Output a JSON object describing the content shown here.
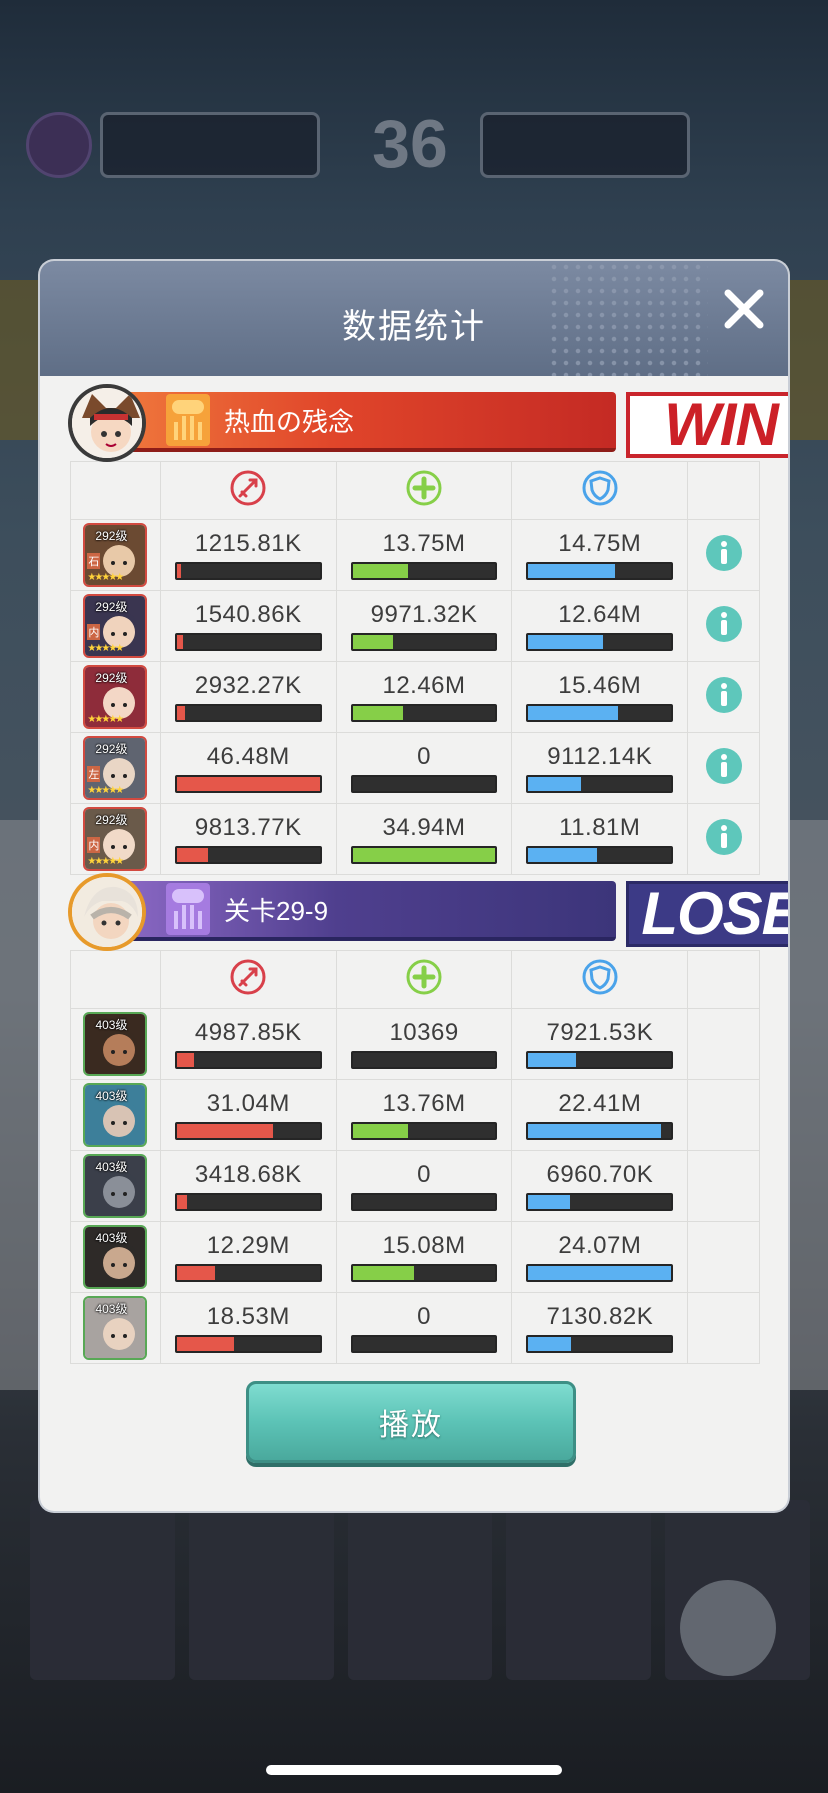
{
  "background": {
    "score": "36"
  },
  "modal": {
    "title": "数据统计",
    "play_label": "播放"
  },
  "team_win": {
    "name": "热血の残念",
    "result": "WIN",
    "heroes": [
      {
        "level": "292级",
        "tag": "石",
        "dmg": "1215.81K",
        "heal": "13.75M",
        "tank": "14.75M",
        "dmg_pct": 3,
        "heal_pct": 39,
        "tank_pct": 61
      },
      {
        "level": "292级",
        "tag": "内",
        "dmg": "1540.86K",
        "heal": "9971.32K",
        "tank": "12.64M",
        "dmg_pct": 4,
        "heal_pct": 28,
        "tank_pct": 52
      },
      {
        "level": "292级",
        "tag": "",
        "dmg": "2932.27K",
        "heal": "12.46M",
        "tank": "15.46M",
        "dmg_pct": 6,
        "heal_pct": 35,
        "tank_pct": 63
      },
      {
        "level": "292级",
        "tag": "左",
        "dmg": "46.48M",
        "heal": "0",
        "tank": "9112.14K",
        "dmg_pct": 100,
        "heal_pct": 0,
        "tank_pct": 37
      },
      {
        "level": "292级",
        "tag": "内",
        "dmg": "9813.77K",
        "heal": "34.94M",
        "tank": "11.81M",
        "dmg_pct": 22,
        "heal_pct": 100,
        "tank_pct": 48
      }
    ]
  },
  "team_lose": {
    "name": "关卡29-9",
    "result": "LOSE",
    "heroes": [
      {
        "level": "403级",
        "dmg": "4987.85K",
        "heal": "10369",
        "tank": "7921.53K",
        "dmg_pct": 12,
        "heal_pct": 0,
        "tank_pct": 33
      },
      {
        "level": "403级",
        "dmg": "31.04M",
        "heal": "13.76M",
        "tank": "22.41M",
        "dmg_pct": 67,
        "heal_pct": 39,
        "tank_pct": 93
      },
      {
        "level": "403级",
        "dmg": "3418.68K",
        "heal": "0",
        "tank": "6960.70K",
        "dmg_pct": 7,
        "heal_pct": 0,
        "tank_pct": 29
      },
      {
        "level": "403级",
        "dmg": "12.29M",
        "heal": "15.08M",
        "tank": "24.07M",
        "dmg_pct": 27,
        "heal_pct": 43,
        "tank_pct": 100
      },
      {
        "level": "403级",
        "dmg": "18.53M",
        "heal": "0",
        "tank": "7130.82K",
        "dmg_pct": 40,
        "heal_pct": 0,
        "tank_pct": 30
      }
    ]
  },
  "colors": {
    "damage": "#e5574a",
    "heal": "#86cf48",
    "shield": "#5bb1f2",
    "info": "#5ec7bb",
    "win_red": "#cc2027",
    "lose_purple": "#3c3a86"
  },
  "icons": {
    "damage_header": "damage-icon",
    "heal_header": "heal-icon",
    "shield_header": "shield-icon",
    "info": "info-icon",
    "close": "close-icon"
  }
}
